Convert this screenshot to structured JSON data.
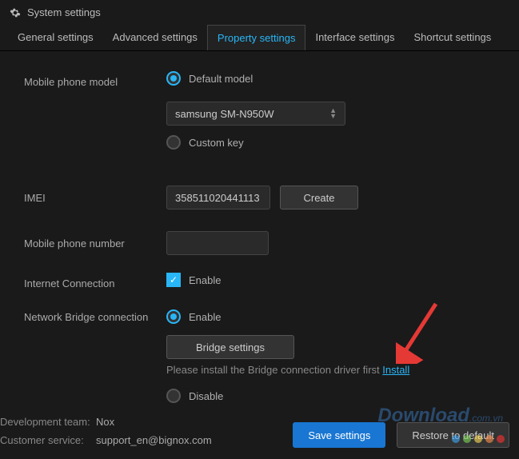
{
  "header": {
    "title": "System settings"
  },
  "tabs": {
    "general": "General settings",
    "advanced": "Advanced settings",
    "property": "Property settings",
    "interface": "Interface settings",
    "shortcut": "Shortcut settings"
  },
  "rows": {
    "model_label": "Mobile phone model",
    "default_model": "Default model",
    "model_select": "samsung SM-N950W",
    "custom_key": "Custom key",
    "imei_label": "IMEI",
    "imei_value": "358511020441113",
    "create": "Create",
    "phone_number_label": "Mobile phone number",
    "phone_number_value": "",
    "internet_label": "Internet Connection",
    "enable": "Enable",
    "bridge_label": "Network Bridge connection",
    "bridge_settings": "Bridge settings",
    "bridge_hint": "Please install the Bridge connection driver first ",
    "install": "Install",
    "disable": "Disable"
  },
  "footer": {
    "dev_label": "Development team:",
    "dev_value": "Nox",
    "cs_label": "Customer service:",
    "cs_value": "support_en@bignox.com",
    "save": "Save settings",
    "restore": "Restore to default"
  },
  "watermark": "Download",
  "watermark_vn": ".com.vn"
}
